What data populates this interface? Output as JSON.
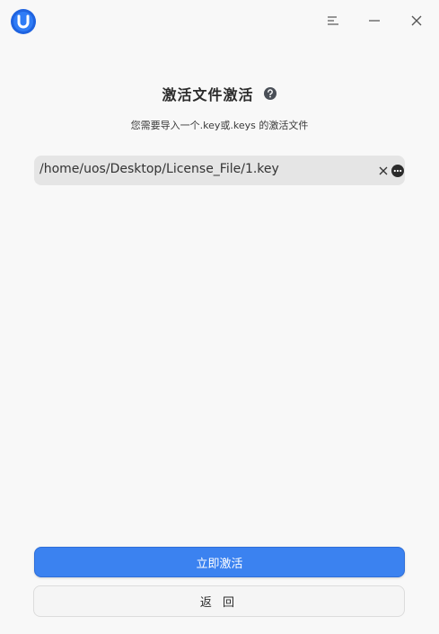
{
  "titlebar": {
    "logo_icon": "uos-logo-icon",
    "menu_icon": "menu-icon",
    "minimize_icon": "minimize-icon",
    "close_icon": "close-icon"
  },
  "main": {
    "title": "激活文件激活",
    "help_icon": "help-icon",
    "subtitle": "您需要导入一个.key或.keys 的激活文件",
    "file_path": "/home/uos/Desktop/License_File/1.key",
    "clear_icon": "clear-icon",
    "browse_icon": "more-icon"
  },
  "buttons": {
    "activate_label": "立即激活",
    "back_label": "返 回"
  },
  "colors": {
    "accent": "#3b82f0",
    "background": "#f8f8f8",
    "field": "#e5e5e5"
  }
}
